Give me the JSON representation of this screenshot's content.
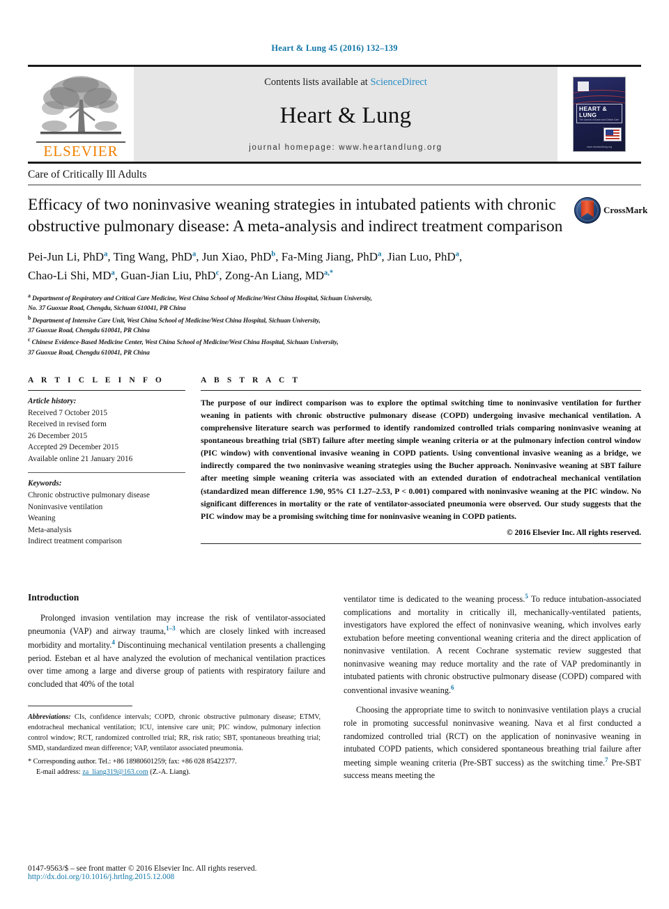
{
  "running_head": "Heart & Lung 45 (2016) 132–139",
  "masthead": {
    "publisher_name": "ELSEVIER",
    "contents_prefix": "Contents lists available at ",
    "contents_link": "ScienceDirect",
    "journal_title": "Heart & Lung",
    "homepage": "journal homepage: www.heartandlung.org",
    "cover": {
      "title": "HEART & LUNG",
      "subtitle": "The Journal of Acute and Critical Care",
      "url": "www.heartandlung.org"
    }
  },
  "section_label": "Care of Critically Ill Adults",
  "title": "Efficacy of two noninvasive weaning strategies in intubated patients with chronic obstructive pulmonary disease: A meta-analysis and indirect treatment comparison",
  "crossmark_label": "CrossMark",
  "authors_line_1": "Pei-Jun Li, PhD a, Ting Wang, PhD a, Jun Xiao, PhD b, Fa-Ming Jiang, PhD a, Jian Luo, PhD a,",
  "authors_line_2": "Chao-Li Shi, MD a, Guan-Jian Liu, PhD c, Zong-An Liang, MD a,*",
  "authors": [
    {
      "name": "Pei-Jun Li, PhD",
      "marker": "a"
    },
    {
      "name": "Ting Wang, PhD",
      "marker": "a"
    },
    {
      "name": "Jun Xiao, PhD",
      "marker": "b"
    },
    {
      "name": "Fa-Ming Jiang, PhD",
      "marker": "a"
    },
    {
      "name": "Jian Luo, PhD",
      "marker": "a"
    },
    {
      "name": "Chao-Li Shi, MD",
      "marker": "a"
    },
    {
      "name": "Guan-Jian Liu, PhD",
      "marker": "c"
    },
    {
      "name": "Zong-An Liang, MD",
      "marker": "a,*"
    }
  ],
  "affiliations": [
    {
      "marker": "a",
      "line1": "Department of Respiratory and Critical Care Medicine, West China School of Medicine/West China Hospital, Sichuan University,",
      "line2": "No. 37 Guoxue Road, Chengdu, Sichuan 610041, PR China"
    },
    {
      "marker": "b",
      "line1": "Department of Intensive Care Unit, West China School of Medicine/West China Hospital, Sichuan University,",
      "line2": "37 Guoxue Road, Chengdu 610041, PR China"
    },
    {
      "marker": "c",
      "line1": "Chinese Evidence-Based Medicine Center, West China School of Medicine/West China Hospital, Sichuan University,",
      "line2": "37 Guoxue Road, Chengdu 610041, PR China"
    }
  ],
  "article_info": {
    "heading": "A R T I C L E   I N F O",
    "history_label": "Article history:",
    "history": [
      "Received 7 October 2015",
      "Received in revised form",
      "26 December 2015",
      "Accepted 29 December 2015",
      "Available online 21 January 2016"
    ],
    "keywords_label": "Keywords:",
    "keywords": [
      "Chronic obstructive pulmonary disease",
      "Noninvasive ventilation",
      "Weaning",
      "Meta-analysis",
      "Indirect treatment comparison"
    ]
  },
  "abstract": {
    "heading": "A B S T R A C T",
    "text": "The purpose of our indirect comparison was to explore the optimal switching time to noninvasive ventilation for further weaning in patients with chronic obstructive pulmonary disease (COPD) undergoing invasive mechanical ventilation. A comprehensive literature search was performed to identify randomized controlled trials comparing noninvasive weaning at spontaneous breathing trial (SBT) failure after meeting simple weaning criteria or at the pulmonary infection control window (PIC window) with conventional invasive weaning in COPD patients. Using conventional invasive weaning as a bridge, we indirectly compared the two noninvasive weaning strategies using the Bucher approach. Noninvasive weaning at SBT failure after meeting simple weaning criteria was associated with an extended duration of endotracheal mechanical ventilation (standardized mean difference 1.90, 95% CI 1.27–2.53, P < 0.001) compared with noninvasive weaning at the PIC window. No significant differences in mortality or the rate of ventilator-associated pneumonia were observed. Our study suggests that the PIC window may be a promising switching time for noninvasive weaning in COPD patients.",
    "copyright": "© 2016 Elsevier Inc. All rights reserved."
  },
  "body": {
    "heading": "Introduction",
    "left_paragraph_1": "Prolonged invasion ventilation may increase the risk of ventilator-associated pneumonia (VAP) and airway trauma,",
    "left_ref_1": "1–3",
    "left_paragraph_1b": " which are closely linked with increased morbidity and mortality.",
    "left_ref_2": "4",
    "left_paragraph_1c": " Discontinuing mechanical ventilation presents a challenging period. Esteban et al have analyzed the evolution of mechanical ventilation practices over time among a large and diverse group of patients with respiratory failure and concluded that 40% of the total",
    "right_paragraph_1a": "ventilator time is dedicated to the weaning process.",
    "right_ref_1": "5",
    "right_paragraph_1b": " To reduce intubation-associated complications and mortality in critically ill, mechanically-ventilated patients, investigators have explored the effect of noninvasive weaning, which involves early extubation before meeting conventional weaning criteria and the direct application of noninvasive ventilation. A recent Cochrane systematic review suggested that noninvasive weaning may reduce mortality and the rate of VAP predominantly in intubated patients with chronic obstructive pulmonary disease (COPD) compared with conventional invasive weaning.",
    "right_ref_2": "6",
    "right_paragraph_2a": "Choosing the appropriate time to switch to noninvasive ventilation plays a crucial role in promoting successful noninvasive weaning. Nava et al first conducted a randomized controlled trial (RCT) on the application of noninvasive weaning in intubated COPD patients, which considered spontaneous breathing trial failure after meeting simple weaning criteria (Pre-SBT success) as the switching time.",
    "right_ref_3": "7",
    "right_paragraph_2b": " Pre-SBT success means meeting the"
  },
  "footnote": {
    "abbrev_label": "Abbreviations:",
    "abbrev_text": " CIs, confidence intervals; COPD, chronic obstructive pulmonary disease; ETMV, endotracheal mechanical ventilation; ICU, intensive care unit; PIC window, pulmonary infection control window; RCT, randomized controlled trial; RR, risk ratio; SBT, spontaneous breathing trial; SMD, standardized mean difference; VAP, ventilator associated pneumonia.",
    "corresponding": "* Corresponding author. Tel.: +86 18980601259; fax: +86 028 85422377.",
    "email_label": "E-mail address:",
    "email": "za_liang319@163.com",
    "email_suffix": " (Z.-A. Liang)."
  },
  "page_footer": {
    "issn_line": "0147-9563/$ – see front matter © 2016 Elsevier Inc. All rights reserved.",
    "doi_line": "http://dx.doi.org/10.1016/j.hrtlng.2015.12.008"
  },
  "colors": {
    "link_blue": "#1176a8",
    "sciencedirect_blue": "#2b8cc4",
    "elsevier_orange": "#f08000",
    "masthead_grey": "#e6e6e6"
  }
}
